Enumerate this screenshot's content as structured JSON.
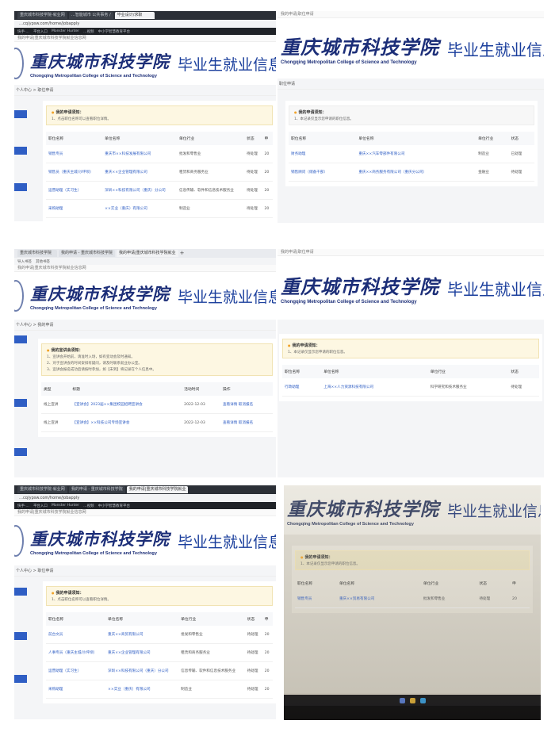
{
  "site": {
    "logo_cn": "重庆城市科技学院",
    "logo_en": "Chongqing Metropolitan College of Science and Technology",
    "job_title": "毕业生就业信息"
  },
  "panel1": {
    "address": "…cq/ypsw.com/home/jobapply",
    "tabs": [
      "重庆城市科技学院-就业网",
      "…智能城市 公共事务 /",
      "毕业设计/求职"
    ],
    "bookmarks": [
      "快手·…",
      "平台入口",
      "Monster Hunter",
      "…视频",
      "中小学智慧教育平台"
    ],
    "page_title": "我的申请|重庆城市科技学院就业信息网",
    "crumb": "个人中心 > 职位申请",
    "notice_title": "我的申请须知：",
    "notice_lines": [
      "1、点击职位名称可以查看职位详情。"
    ],
    "headers": [
      "职位名称",
      "单位名称",
      "单位行业",
      "状态",
      "申"
    ],
    "rows": [
      [
        "销售专员",
        "重庆市××科技发展有限公司",
        "批发和零售业",
        "待处理",
        "20"
      ],
      [
        "销售员（重庆主城/沙坪坝）",
        "重庆××企业管理有限公司",
        "租赁和商务服务业",
        "待处理",
        "20"
      ],
      [
        "运营助理（实习生）",
        "深圳××科技有限公司（重庆）分公司",
        "信息传输、软件和信息技术服务业",
        "待处理",
        "20"
      ],
      [
        "采购助理",
        "××实业（重庆）有限公司",
        "制造业",
        "待处理",
        "20"
      ]
    ]
  },
  "panel2": {
    "page_title": "我的申请|职位申请",
    "crumb": "职位申请",
    "notice_title": "我的申请须知：",
    "notice_lines": [
      "1、本记录仅显示您申请的职位信息。"
    ],
    "headers": [
      "职位名称",
      "单位名称",
      "单位行业",
      "状态"
    ],
    "rows": [
      [
        "财务助理",
        "重庆××汽车零部件有限公司",
        "制造业",
        "已处理"
      ],
      [
        "销售顾问（储备干部）",
        "重庆××商务服务有限公司（重庆分公司）",
        "金融业",
        "待处理"
      ]
    ]
  },
  "panel3": {
    "tabs": [
      "重庆城市科技学院",
      "我的申请 - 重庆城市科技学院",
      "我的申请|重庆城市科技学院就业"
    ],
    "bookmarks": [
      "导入书签",
      "其他书签"
    ],
    "page_title": "我的申请|重庆城市科技学院就业信息网",
    "crumb": "个人中心 > 我的申请",
    "notice_title": "我的宣讲会须知：",
    "notice_lines": [
      "1、宣讲会开始前，请准时入场，如有变动会及时通知。",
      "2、对于宣讲会的时间安排有疑问，请及时联系就业办公室。",
      "3、宣讲会报名成功后请按时参加，如【未到】将记录在个人信息中。"
    ],
    "headers": [
      "类型",
      "标题",
      "活动时间",
      "操作"
    ],
    "rows": [
      [
        "线上宣讲",
        "【宣讲会】2023届××集团校园招聘宣讲会",
        "2022-12-03",
        "查看详情  取消报名"
      ],
      [
        "线上宣讲",
        "【宣讲会】××科技公司专场宣讲会",
        "2022-12-03",
        "查看详情  取消报名"
      ]
    ]
  },
  "panel4": {
    "page_title": "我的申请|职位申请",
    "notice_title": "我的申请须知：",
    "notice_lines": [
      "1、本记录仅显示您申请的职位信息。"
    ],
    "headers": [
      "职位名称",
      "单位名称",
      "单位行业",
      "状态"
    ],
    "rows": [
      [
        "行政助理",
        "上海××人力资源科技有限公司",
        "科学研究和技术服务业",
        "待处理"
      ]
    ]
  },
  "panel5": {
    "address": "…cq/ypsw.com/home/jobapply",
    "tabs": [
      "重庆城市科技学院-就业网",
      "我的申请 - 重庆城市科技学院",
      "我的申请|重庆城市科技学院就业"
    ],
    "bookmarks": [
      "快手·…",
      "平台入口",
      "Monster Hunter",
      "…视频",
      "中小学智慧教育平台"
    ],
    "page_title": "我的申请|重庆城市科技学院就业信息网",
    "crumb": "个人中心 > 职位申请",
    "notice_title": "我的申请须知：",
    "notice_lines": [
      "1、点击职位名称可以查看职位详情。"
    ],
    "headers": [
      "职位名称",
      "单位名称",
      "单位行业",
      "状态",
      "申"
    ],
    "rows": [
      [
        "前台文员",
        "重庆××商贸有限公司",
        "批发和零售业",
        "待处理",
        "20"
      ],
      [
        "人事专员（重庆主城/沙坪坝）",
        "重庆××企业管理有限公司",
        "租赁和商务服务业",
        "待处理",
        "20"
      ],
      [
        "运营助理（实习生）",
        "深圳××科技有限公司（重庆）分公司",
        "信息传输、软件和信息技术服务业",
        "待处理",
        "20"
      ],
      [
        "采购助理",
        "××实业（重庆）有限公司",
        "制造业",
        "待处理",
        "20"
      ]
    ]
  },
  "panel6": {
    "notice_title": "我的申请须知：",
    "notice_lines": [
      "1、本记录仅显示您申请的职位信息。"
    ],
    "headers": [
      "职位名称",
      "单位名称",
      "单位行业",
      "状态",
      "申"
    ],
    "rows": [
      [
        "销售专员",
        "重庆××贸易有限公司",
        "批发和零售业",
        "待处理",
        "20"
      ]
    ]
  }
}
